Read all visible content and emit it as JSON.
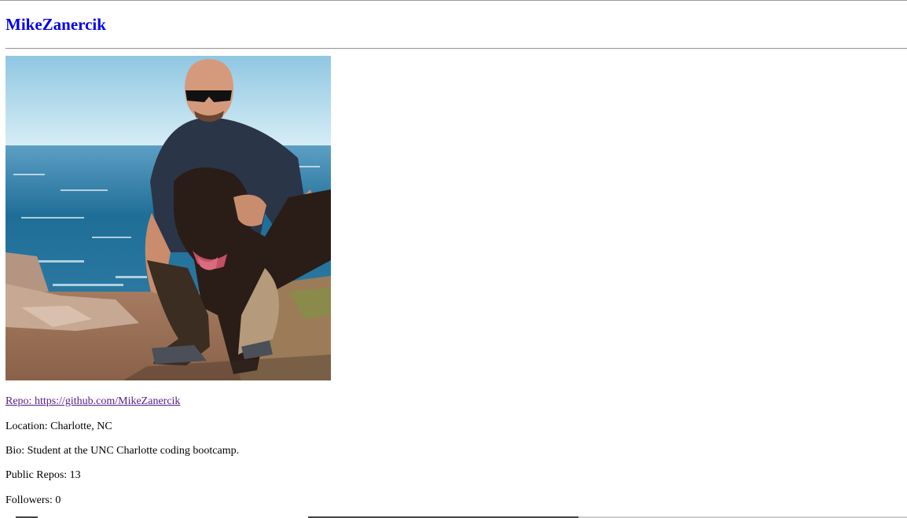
{
  "profile": {
    "username": "MikeZanercik",
    "avatar_alt": "MikeZanercik",
    "repo_prefix": "Repo: ",
    "repo_url": "https://github.com/MikeZanercik",
    "location_label": "Location: ",
    "location": "Charlotte, NC",
    "bio_label": "Bio: ",
    "bio": "Student at the UNC Charlotte coding bootcamp.",
    "public_repos_label": "Public Repos: ",
    "public_repos": "13",
    "followers_label": "Followers: ",
    "followers": "0"
  },
  "colors": {
    "username_link": "#0000ee",
    "visited_link": "#551a8b",
    "rule": "#9a9a9a"
  }
}
